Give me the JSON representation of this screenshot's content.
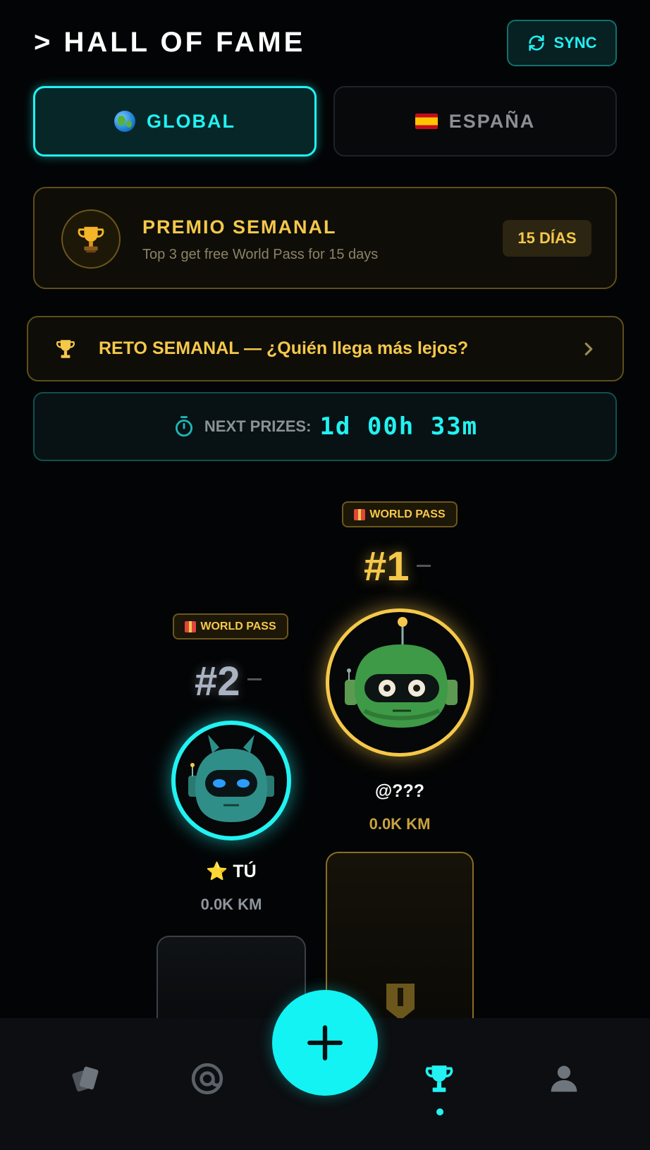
{
  "header": {
    "title": "> HALL OF FAME",
    "sync_label": "SYNC"
  },
  "tabs": [
    {
      "label": "GLOBAL",
      "icon": "globe-icon",
      "active": true
    },
    {
      "label": "ESPAÑA",
      "icon": "spain-flag-icon",
      "active": false
    }
  ],
  "weekly_prize": {
    "title": "PREMIO SEMANAL",
    "subtitle": "Top 3 get free World Pass for 15 days",
    "badge": "15 DÍAS",
    "icon": "trophy-icon"
  },
  "challenge": {
    "text": "RETO SEMANAL — ¿Quién llega más lejos?",
    "icon": "trophy-icon"
  },
  "countdown": {
    "label": "NEXT PRIZES:",
    "value": "1d 00h 33m",
    "icon": "stopwatch-icon"
  },
  "podium": [
    {
      "rank": "#1",
      "badge": "WORLD PASS",
      "name": "@???",
      "distance": "0.0K KM",
      "avatar": "green-robot-avatar"
    },
    {
      "rank": "#2",
      "badge": "WORLD PASS",
      "name": "⭐ TÚ",
      "distance": "0.0K KM",
      "avatar": "teal-horned-robot-avatar"
    }
  ],
  "nav": {
    "items": [
      "cards-icon",
      "radar-icon",
      "add-icon",
      "trophy-icon",
      "profile-icon"
    ],
    "active": "trophy-icon"
  },
  "colors": {
    "accent": "#22f2f2",
    "gold": "#f5c84a",
    "background": "#030405"
  }
}
